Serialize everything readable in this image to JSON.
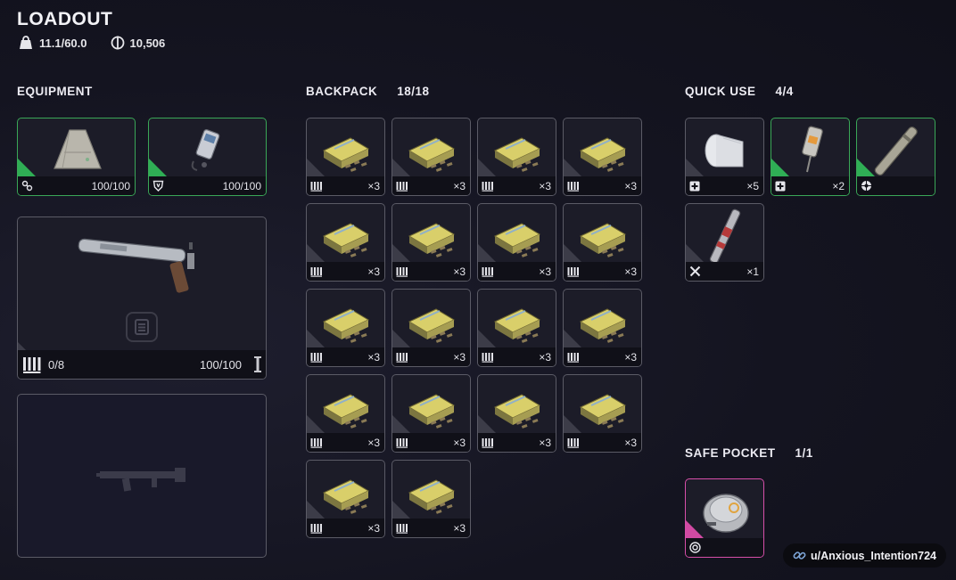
{
  "header": {
    "title": "LOADOUT",
    "weight": "11.1/60.0",
    "currency": "10,506"
  },
  "equipment": {
    "label": "EQUIPMENT",
    "augment": {
      "durability": "100/100",
      "icon": "augment-icon"
    },
    "shield": {
      "durability": "100/100",
      "icon": "shield-icon"
    },
    "primary_weapon": {
      "ammo": "0/8",
      "durability": "100/100",
      "icon": "rifle-icon"
    },
    "secondary_weapon": {
      "icon": "smg-silhouette-icon"
    }
  },
  "backpack": {
    "label": "BACKPACK",
    "count": "18/18",
    "items": [
      {
        "qty": "×3"
      },
      {
        "qty": "×3"
      },
      {
        "qty": "×3"
      },
      {
        "qty": "×3"
      },
      {
        "qty": "×3"
      },
      {
        "qty": "×3"
      },
      {
        "qty": "×3"
      },
      {
        "qty": "×3"
      },
      {
        "qty": "×3"
      },
      {
        "qty": "×3"
      },
      {
        "qty": "×3"
      },
      {
        "qty": "×3"
      },
      {
        "qty": "×3"
      },
      {
        "qty": "×3"
      },
      {
        "qty": "×3"
      },
      {
        "qty": "×3"
      },
      {
        "qty": "×3"
      },
      {
        "qty": "×3"
      }
    ]
  },
  "quick_use": {
    "label": "QUICK USE",
    "count": "4/4",
    "items": [
      {
        "name": "bandage",
        "qty": "×5",
        "type_icon": "heal-icon"
      },
      {
        "name": "injector",
        "qty": "×2",
        "type_icon": "heal-icon"
      },
      {
        "name": "tube",
        "qty": "",
        "type_icon": "grenade-icon"
      },
      {
        "name": "flare",
        "qty": "×1",
        "type_icon": "tools-icon"
      }
    ]
  },
  "safe_pocket": {
    "label": "SAFE POCKET",
    "count": "1/1",
    "item": {
      "name": "device",
      "type_icon": "target-icon"
    }
  },
  "watermark": "u/Anxious_Intention724",
  "colors": {
    "common": "#3c3c48",
    "uncommon": "#2fae55",
    "epic": "#d14aa3"
  }
}
